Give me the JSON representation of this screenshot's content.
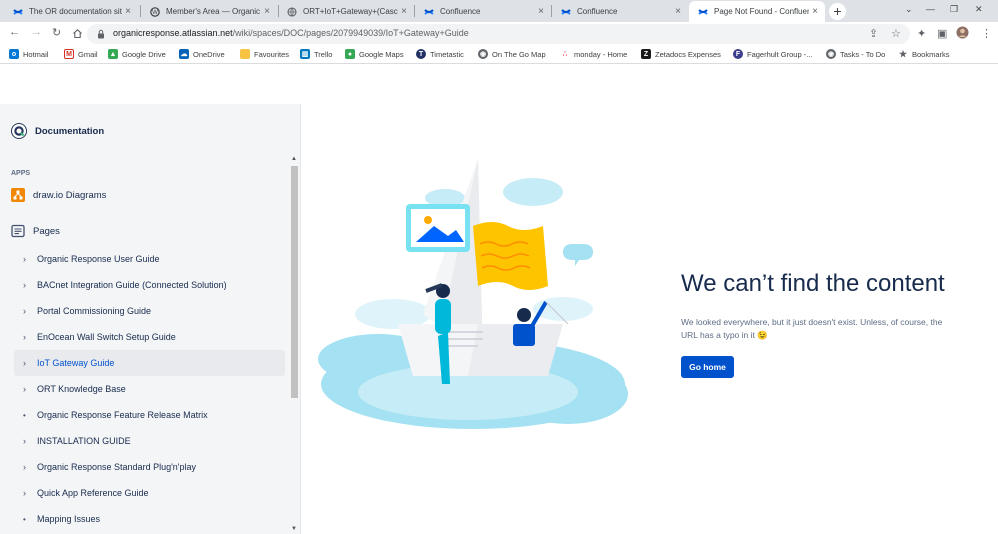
{
  "browser": {
    "tabs": [
      {
        "title": "The OR documentation site"
      },
      {
        "title": "Member's Area — Organic"
      },
      {
        "title": "ORT+IoT+Gateway+(Casca"
      },
      {
        "title": "Confluence"
      },
      {
        "title": "Confluence"
      },
      {
        "title": "Page Not Found - Confluen"
      }
    ],
    "url_host": "organicresponse.atlassian.net",
    "url_path": "/wiki/spaces/DOC/pages/2079949039/IoT+Gateway+Guide",
    "bookmarks": [
      {
        "label": "Hotmail",
        "color": "#0078d4"
      },
      {
        "label": "Gmail",
        "color": "#d93025"
      },
      {
        "label": "Google Drive",
        "color": "#34a853"
      },
      {
        "label": "OneDrive",
        "color": "#0364b8"
      },
      {
        "label": "Favourites",
        "color": "#f6c343"
      },
      {
        "label": "Trello",
        "color": "#0079bf"
      },
      {
        "label": "Google Maps",
        "color": "#34a853"
      },
      {
        "label": "Timetastic",
        "color": "#223266"
      },
      {
        "label": "On The Go Map",
        "color": "#5f6368"
      },
      {
        "label": "monday - Home",
        "color": "#f62b54"
      },
      {
        "label": "Zetadocs Expenses",
        "color": "#1a1a1a"
      },
      {
        "label": "Fagerhult Group -...",
        "color": "#3c3c8c"
      },
      {
        "label": "Tasks - To Do",
        "color": "#5f6368"
      },
      {
        "label": "Bookmarks",
        "color": "#5f6368"
      }
    ]
  },
  "sidebar": {
    "space_name": "Documentation",
    "apps_heading": "APPS",
    "app_item": "draw.io Diagrams",
    "pages_label": "Pages",
    "tree": [
      {
        "label": "Organic Response User Guide",
        "marker": "›",
        "active": false
      },
      {
        "label": "BACnet Integration Guide (Connected Solution)",
        "marker": "›",
        "active": false
      },
      {
        "label": "Portal Commissioning Guide",
        "marker": "›",
        "active": false
      },
      {
        "label": "EnOcean Wall Switch Setup Guide",
        "marker": "›",
        "active": false
      },
      {
        "label": "IoT Gateway Guide",
        "marker": "›",
        "active": true
      },
      {
        "label": "ORT Knowledge Base",
        "marker": "›",
        "active": false
      },
      {
        "label": "Organic Response Feature Release Matrix",
        "marker": "•",
        "active": false
      },
      {
        "label": "INSTALLATION GUIDE",
        "marker": "›",
        "active": false
      },
      {
        "label": "Organic Response Standard Plug'n'play",
        "marker": "›",
        "active": false
      },
      {
        "label": "Quick App Reference Guide",
        "marker": "›",
        "active": false
      },
      {
        "label": "Mapping Issues",
        "marker": "•",
        "active": false
      }
    ]
  },
  "main": {
    "heading": "We can’t find the content",
    "message": "We looked everywhere, but it just doesn't exist. Unless, of course, the URL has a typo in it 😉",
    "button_label": "Go home"
  }
}
